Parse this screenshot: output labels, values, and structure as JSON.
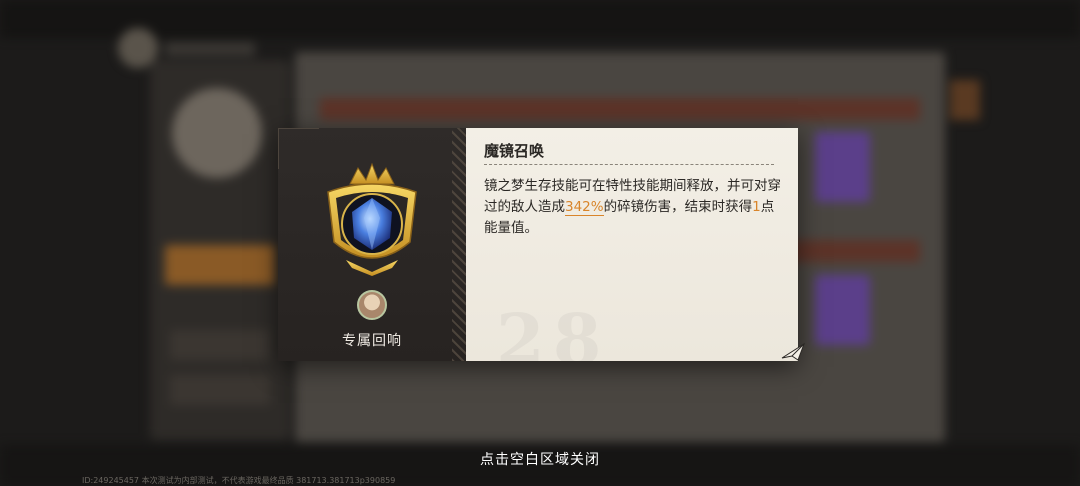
{
  "modal": {
    "exclusive_label": "专属回响",
    "skill_title": "魔镜召唤",
    "desc_part1": "镜之梦生存技能可在特性技能期间释放，并可对穿过的敌人造成",
    "desc_value": "342%",
    "desc_part2": "的碎镜伤害，结束时获得",
    "desc_count": "1",
    "desc_part3": "点能量值。",
    "watermark": "28"
  },
  "footer": {
    "close_hint": "点击空白区域关闭",
    "build_info": "ID:249245457 本次测试为内部测试，不代表游戏最终品质 381713.381713p390859"
  },
  "colors": {
    "accent_orange": "#d9852b",
    "badge_gold": "#e2b83c",
    "crystal_blue": "#3b6fd6"
  },
  "icons": [
    "gold-crown-badge-icon",
    "blue-crystal-icon",
    "character-avatar-icon",
    "paper-plane-corner-icon"
  ]
}
